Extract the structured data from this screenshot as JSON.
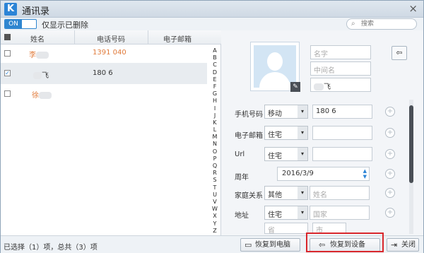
{
  "window": {
    "title": "通讯录",
    "logo": "K",
    "close": "×"
  },
  "toolbar": {
    "toggle_label": "ON",
    "toggle_text": "仅显示已删除",
    "search_placeholder": "搜索",
    "search_icon": "⌕"
  },
  "table": {
    "headers": [
      "姓名",
      "电话号码",
      "电子邮箱"
    ],
    "rows": [
      {
        "name": "李",
        "phone": "1391  040",
        "email": "",
        "checked": false
      },
      {
        "name": "飞",
        "phone": "180  6",
        "email": "",
        "checked": true
      },
      {
        "name": "徐",
        "phone": "",
        "email": "",
        "checked": false
      }
    ],
    "check_mark": "✓"
  },
  "alphabet": [
    "A",
    "B",
    "C",
    "D",
    "E",
    "F",
    "G",
    "H",
    "I",
    "J",
    "K",
    "L",
    "M",
    "N",
    "O",
    "P",
    "Q",
    "R",
    "S",
    "T",
    "U",
    "V",
    "W",
    "X",
    "Y",
    "Z"
  ],
  "detail": {
    "first_name_placeholder": "名字",
    "middle_name_placeholder": "中间名",
    "last_name_value": "飞",
    "edit_icon": "✎",
    "import_icon": "⇦",
    "fields": {
      "phone_label": "手机号码",
      "phone_type": "移动",
      "phone_value": "180  6",
      "email_label": "电子邮箱",
      "email_type": "住宅",
      "url_label": "Url",
      "url_type": "住宅",
      "anniversary_label": "周年",
      "anniversary_value": "2016/3/9",
      "relation_label": "家庭关系",
      "relation_type": "其他",
      "relation_placeholder": "姓名",
      "address_label": "地址",
      "address_type": "住宅",
      "country_placeholder": "国家",
      "province_placeholder": "省",
      "city_placeholder": "市"
    },
    "plus": "+",
    "dropdown_arrow": "▾"
  },
  "status": {
    "summary": "已选择（1）项，总共（3）项",
    "restore_pc_label": "恢复到电脑",
    "restore_device_label": "恢复到设备",
    "close_label": "关闭",
    "pc_icon": "▭",
    "device_icon": "⇦",
    "close_icon": "⇥"
  },
  "colors": {
    "accent": "#2c84d6",
    "highlight": "#d9262b",
    "name_text": "#e07a3a"
  }
}
